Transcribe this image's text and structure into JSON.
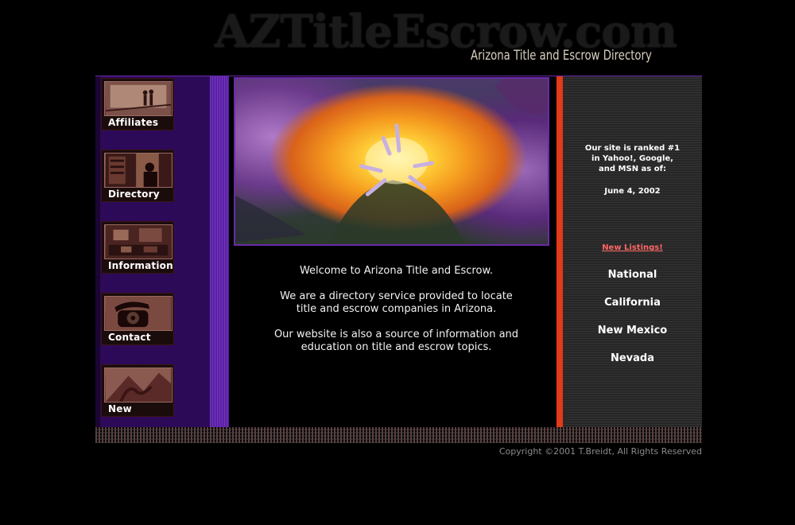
{
  "header": {
    "logo_text": "AZTitleEscrow.com",
    "tagline": "Arizona Title and Escrow Directory"
  },
  "nav": {
    "items": [
      {
        "label": "Affiliates",
        "icon": "people-photo-icon"
      },
      {
        "label": "Directory",
        "icon": "bookshelf-silhouette-icon"
      },
      {
        "label": "Information",
        "icon": "office-desk-photo-icon"
      },
      {
        "label": "Contact",
        "icon": "rotary-phone-icon"
      },
      {
        "label": "New",
        "icon": "new-photo-icon"
      }
    ]
  },
  "main": {
    "welcome": "Welcome to Arizona Title and Escrow.",
    "description_line1": "We are a directory service provided to locate",
    "description_line2": "title and escrow companies in Arizona.",
    "info_line1": "Our website is also a source of information and",
    "info_line2": "education on title and escrow topics."
  },
  "sidebar": {
    "rank_line1": "Our site is ranked #1",
    "rank_line2": "in Yahoo!, Google,",
    "rank_line3": "and MSN as of:",
    "rank_date": "June 4, 2002",
    "new_listings": "New Listings!",
    "regions": [
      "National",
      "California",
      "New Mexico",
      "Nevada"
    ]
  },
  "footer": {
    "copyright": "Copyright ©2001 T.Breidt, All Rights Reserved"
  },
  "colors": {
    "nav_background": "#2e0a5a",
    "accent_purple": "#6a2aa8",
    "divider_red": "#e23a1a",
    "new_listings_link": "#ff6666"
  }
}
